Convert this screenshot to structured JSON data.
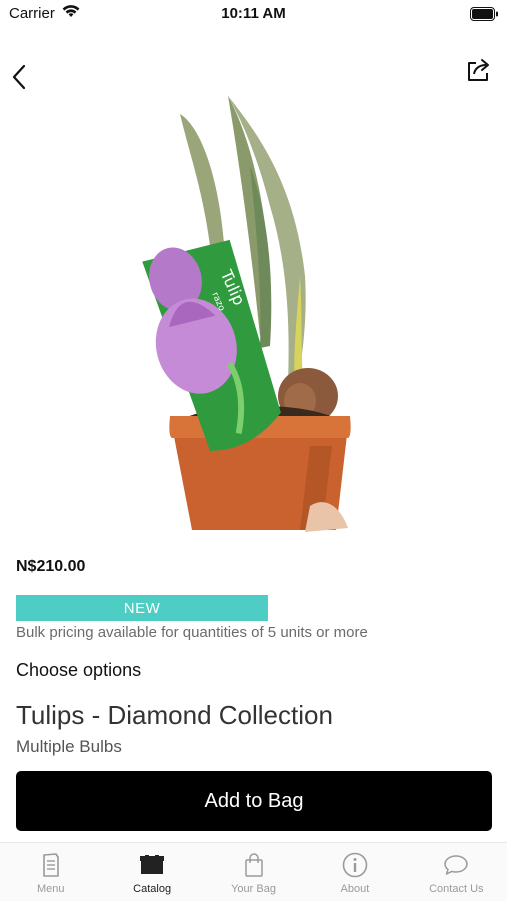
{
  "status_bar": {
    "carrier": "Carrier",
    "time": "10:11 AM"
  },
  "nav": {
    "back_icon": "chevron-left-icon",
    "share_icon": "share-icon"
  },
  "product": {
    "image_description_icon": "tulip-bulbs-in-pot-image",
    "tag_text": "Tulip",
    "tag_subtext": "razo",
    "price": "N$210.00",
    "badge": "NEW",
    "bulk_note": "Bulk pricing available for quantities of 5 units or more",
    "choose_options": "Choose options",
    "name": "Tulips - Diamond Collection",
    "variant": "Multiple Bulbs",
    "add_to_bag": "Add to Bag"
  },
  "colors": {
    "badge": "#4ecdc4",
    "button": "#000000"
  },
  "tabs": [
    {
      "label": "Menu",
      "icon": "menu-book-icon",
      "active": false
    },
    {
      "label": "Catalog",
      "icon": "catalog-box-icon",
      "active": true
    },
    {
      "label": "Your Bag",
      "icon": "shopping-bag-icon",
      "active": false
    },
    {
      "label": "About",
      "icon": "info-icon",
      "active": false
    },
    {
      "label": "Contact Us",
      "icon": "chat-bubble-icon",
      "active": false
    }
  ]
}
